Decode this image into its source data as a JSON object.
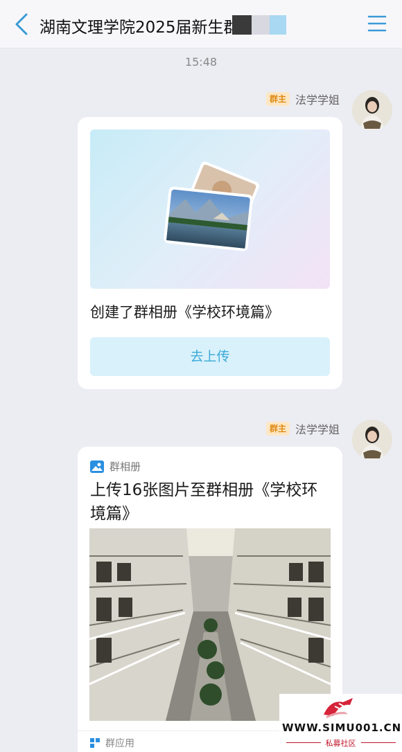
{
  "header": {
    "title": "湖南文理学院2025届新生群"
  },
  "time_divider": "15:48",
  "messages": [
    {
      "badge": "群主",
      "sender": "法学学姐",
      "card_text": "创建了群相册《学校环境篇》",
      "button_label": "去上传"
    },
    {
      "badge": "群主",
      "sender": "法学学姐",
      "app_name": "群相册",
      "card_title": "上传16张图片至群相册《学校环境篇》",
      "footer_label": "群应用"
    }
  ],
  "watermark": {
    "site": "WWW.SIMU001.CN",
    "sub": "私募社区"
  },
  "colors": {
    "accent": "#39a9d8",
    "badge_bg": "#fde7c4",
    "badge_text": "#e08a14",
    "background": "#ececf3"
  },
  "icons": {
    "back": "chevron-left-icon",
    "menu": "hamburger-menu-icon",
    "album_app": "photo-album-icon"
  }
}
